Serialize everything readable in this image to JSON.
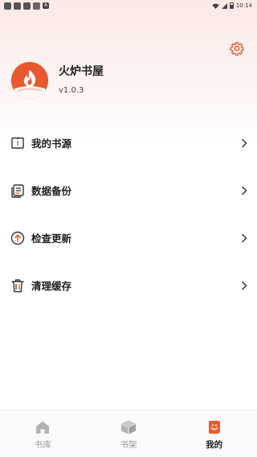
{
  "status_bar": {
    "notification_icons": [
      "app-icon",
      "app-icon",
      "app-icon",
      "image-icon",
      "a-icon"
    ],
    "a_glyph": "A",
    "time": "10:14"
  },
  "profile": {
    "name": "火炉书屋",
    "version": "v1.0.3"
  },
  "menu": {
    "items": [
      {
        "label": "我的书源",
        "icon": "book-source-icon"
      },
      {
        "label": "数据备份",
        "icon": "backup-icon"
      },
      {
        "label": "检查更新",
        "icon": "update-icon"
      },
      {
        "label": "清理缓存",
        "icon": "trash-icon"
      }
    ]
  },
  "bottom_nav": {
    "tabs": [
      {
        "label": "书库",
        "icon": "home-icon",
        "active": false
      },
      {
        "label": "书架",
        "icon": "box-icon",
        "active": false
      },
      {
        "label": "我的",
        "icon": "profile-face-icon",
        "active": true
      }
    ]
  },
  "colors": {
    "accent": "#ee5a24",
    "inactive": "#9a9a9a",
    "text": "#222222"
  }
}
